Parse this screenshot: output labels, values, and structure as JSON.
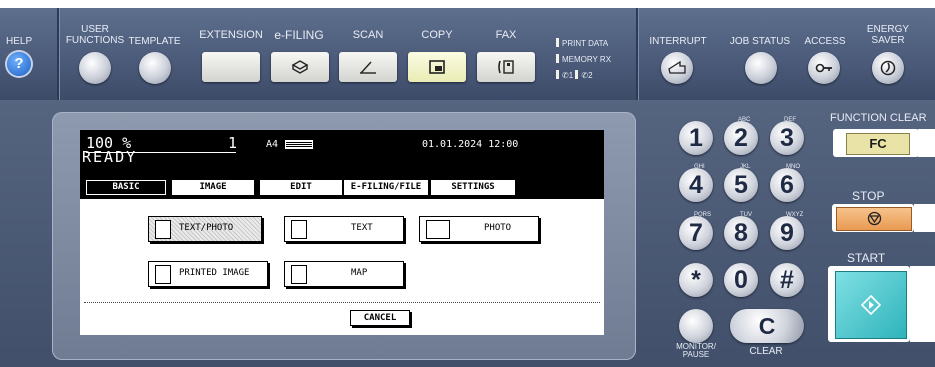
{
  "top_panel": {
    "help_label": "HELP",
    "help_symbol": "?",
    "user_functions_label": "USER\nFUNCTIONS",
    "template_label": "TEMPLATE",
    "modes": [
      {
        "label": "EXTENSION",
        "icon": "extension-icon"
      },
      {
        "label": "e-FILING",
        "icon": "e-filing-icon"
      },
      {
        "label": "SCAN",
        "icon": "scan-icon"
      },
      {
        "label": "COPY",
        "icon": "copy-icon"
      },
      {
        "label": "FAX",
        "icon": "fax-icon"
      }
    ],
    "indicators": {
      "print_data": "PRINT DATA",
      "memory_rx": "MEMORY RX",
      "line1": "1",
      "line2": "2"
    },
    "interrupt_label": "INTERRUPT",
    "job_status_label": "JOB STATUS",
    "access_label": "ACCESS",
    "energy_saver_label": "ENERGY\nSAVER"
  },
  "screen": {
    "ratio": "100 %",
    "copies": "1",
    "paper": "A4",
    "datetime": "01.01.2024 12:00",
    "status": "READY",
    "tabs": [
      "BASIC",
      "IMAGE",
      "EDIT",
      "E-FILING/FILE",
      "SETTINGS"
    ],
    "active_tab": "BASIC",
    "original_modes": [
      "TEXT/PHOTO",
      "TEXT",
      "PHOTO",
      "PRINTED IMAGE",
      "MAP"
    ],
    "selected_mode": "TEXT/PHOTO",
    "cancel_label": "CANCEL"
  },
  "keypad": {
    "keys": [
      "1",
      "2",
      "3",
      "4",
      "5",
      "6",
      "7",
      "8",
      "9",
      "*",
      "0",
      "#"
    ],
    "subs": [
      "ABC",
      "DEF",
      "GHI",
      "JKL",
      "MNO",
      "PQRS",
      "TUV",
      "WXYZ"
    ],
    "monitor_pause_label": "MONITOR/\nPAUSE",
    "clear_label": "CLEAR",
    "clear_symbol": "C"
  },
  "right_controls": {
    "function_clear_label": "FUNCTION CLEAR",
    "fc_label": "FC",
    "stop_label": "STOP",
    "start_label": "START"
  },
  "colors": {
    "panel": "#4a5a78",
    "screen_bg": "#000000",
    "fc_button": "#e9e3a8",
    "stop_button": "#f2b06b",
    "start_button": "#45c2c8"
  }
}
